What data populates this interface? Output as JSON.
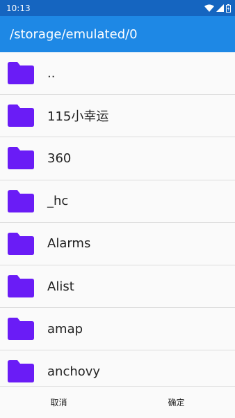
{
  "status_bar": {
    "time": "10:13",
    "icons": [
      "wifi-icon",
      "signal-icon",
      "battery-icon"
    ]
  },
  "app_bar": {
    "path": "/storage/emulated/0"
  },
  "colors": {
    "status_bar": "#1565c0",
    "app_bar": "#1e88e5",
    "folder": "#6a1cf6"
  },
  "files": [
    {
      "name": "..",
      "icon": "folder-icon"
    },
    {
      "name": "115小幸运",
      "icon": "folder-icon"
    },
    {
      "name": "360",
      "icon": "folder-icon"
    },
    {
      "name": "_hc",
      "icon": "folder-icon"
    },
    {
      "name": "Alarms",
      "icon": "folder-icon"
    },
    {
      "name": "Alist",
      "icon": "folder-icon"
    },
    {
      "name": "amap",
      "icon": "folder-icon"
    },
    {
      "name": "anchovy",
      "icon": "folder-icon"
    }
  ],
  "bottom_bar": {
    "cancel_label": "取消",
    "confirm_label": "确定"
  }
}
